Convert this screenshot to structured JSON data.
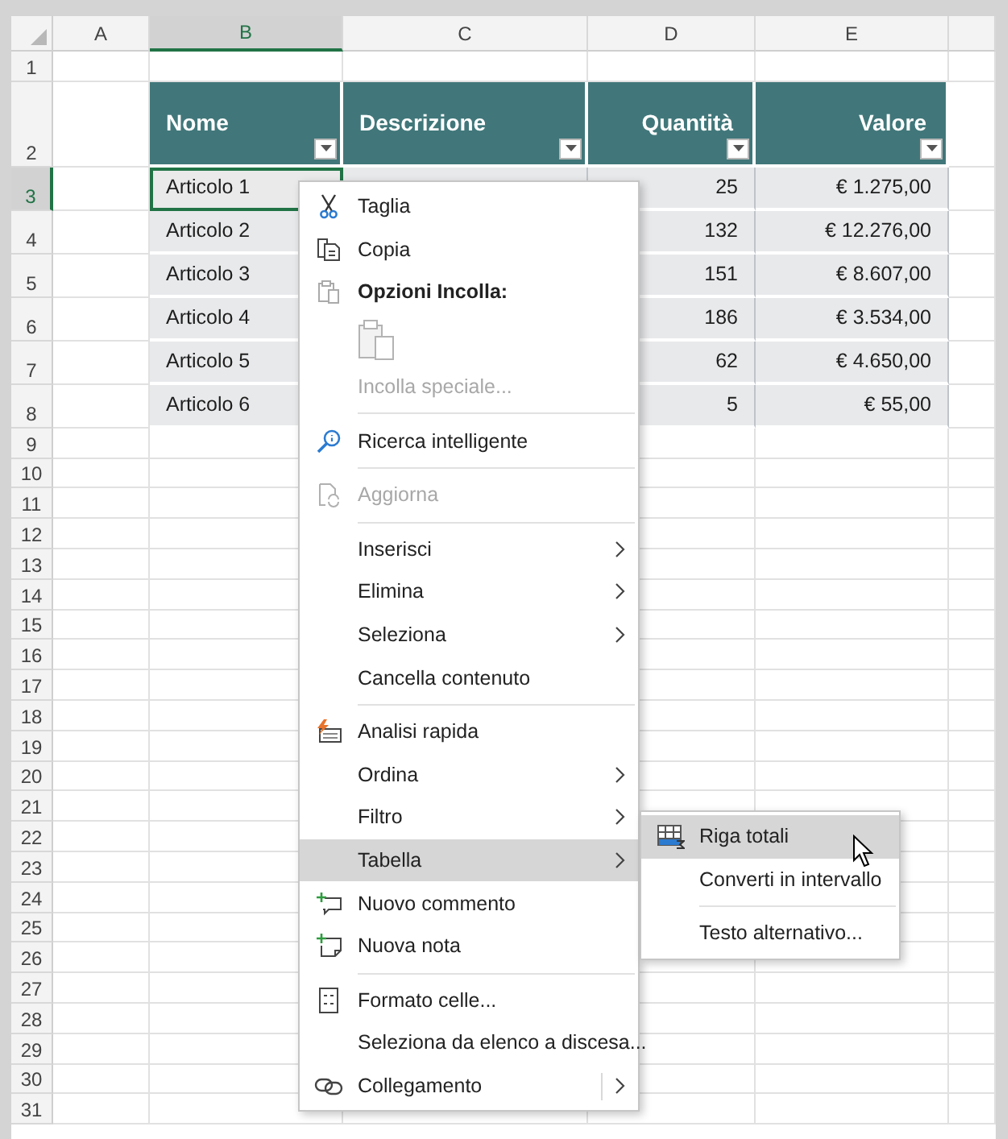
{
  "columns": [
    {
      "label": "A",
      "selected": false
    },
    {
      "label": "B",
      "selected": true
    },
    {
      "label": "C",
      "selected": false
    },
    {
      "label": "D",
      "selected": false
    },
    {
      "label": "E",
      "selected": false
    }
  ],
  "rows": [
    {
      "label": "1",
      "selected": false
    },
    {
      "label": "2",
      "selected": false
    },
    {
      "label": "3",
      "selected": true
    },
    {
      "label": "4",
      "selected": false
    },
    {
      "label": "5",
      "selected": false
    },
    {
      "label": "6",
      "selected": false
    },
    {
      "label": "7",
      "selected": false
    },
    {
      "label": "8",
      "selected": false
    },
    {
      "label": "9",
      "selected": false
    },
    {
      "label": "10",
      "selected": false
    },
    {
      "label": "11",
      "selected": false
    },
    {
      "label": "12",
      "selected": false
    },
    {
      "label": "13",
      "selected": false
    },
    {
      "label": "14",
      "selected": false
    },
    {
      "label": "15",
      "selected": false
    },
    {
      "label": "16",
      "selected": false
    },
    {
      "label": "17",
      "selected": false
    },
    {
      "label": "18",
      "selected": false
    },
    {
      "label": "19",
      "selected": false
    },
    {
      "label": "20",
      "selected": false
    },
    {
      "label": "21",
      "selected": false
    },
    {
      "label": "22",
      "selected": false
    },
    {
      "label": "23",
      "selected": false
    },
    {
      "label": "24",
      "selected": false
    },
    {
      "label": "25",
      "selected": false
    },
    {
      "label": "26",
      "selected": false
    },
    {
      "label": "27",
      "selected": false
    },
    {
      "label": "28",
      "selected": false
    },
    {
      "label": "29",
      "selected": false
    },
    {
      "label": "30",
      "selected": false
    },
    {
      "label": "31",
      "selected": false
    }
  ],
  "table": {
    "headers": [
      {
        "label": "Nome",
        "kind": "text"
      },
      {
        "label": "Descrizione",
        "kind": "text"
      },
      {
        "label": "Quantità",
        "kind": "number"
      },
      {
        "label": "Valore",
        "kind": "number"
      }
    ],
    "rows": [
      {
        "nome": "Articolo 1",
        "quantita": "25",
        "valore": "€ 1.275,00",
        "active": true
      },
      {
        "nome": "Articolo 2",
        "quantita": "132",
        "valore": "€ 12.276,00",
        "active": false
      },
      {
        "nome": "Articolo 3",
        "quantita": "151",
        "valore": "€ 8.607,00",
        "active": false
      },
      {
        "nome": "Articolo 4",
        "quantita": "186",
        "valore": "€ 3.534,00",
        "active": false
      },
      {
        "nome": "Articolo 5",
        "quantita": "62",
        "valore": "€ 4.650,00",
        "active": false
      },
      {
        "nome": "Articolo 6",
        "quantita": "5",
        "valore": "€ 55,00",
        "active": false
      }
    ]
  },
  "context_menu": {
    "items": [
      {
        "kind": "item",
        "label": "Taglia",
        "disabled": false,
        "submenu": false,
        "selected": false
      },
      {
        "kind": "item",
        "label": "Copia",
        "disabled": false,
        "submenu": false,
        "selected": false
      },
      {
        "kind": "header",
        "label": "Opzioni Incolla:"
      },
      {
        "kind": "paste-icons"
      },
      {
        "kind": "item",
        "label": "Incolla speciale...",
        "disabled": true,
        "submenu": false,
        "selected": false
      },
      {
        "kind": "separator"
      },
      {
        "kind": "item",
        "label": "Ricerca intelligente",
        "disabled": false,
        "submenu": false,
        "selected": false
      },
      {
        "kind": "separator"
      },
      {
        "kind": "item",
        "label": "Aggiorna",
        "disabled": true,
        "submenu": false,
        "selected": false
      },
      {
        "kind": "separator"
      },
      {
        "kind": "item",
        "label": "Inserisci",
        "disabled": false,
        "submenu": true,
        "selected": false
      },
      {
        "kind": "item",
        "label": "Elimina",
        "disabled": false,
        "submenu": true,
        "selected": false
      },
      {
        "kind": "item",
        "label": "Seleziona",
        "disabled": false,
        "submenu": true,
        "selected": false
      },
      {
        "kind": "item",
        "label": "Cancella contenuto",
        "disabled": false,
        "submenu": false,
        "selected": false
      },
      {
        "kind": "separator"
      },
      {
        "kind": "item",
        "label": "Analisi rapida",
        "disabled": false,
        "submenu": false,
        "selected": false
      },
      {
        "kind": "item",
        "label": "Ordina",
        "disabled": false,
        "submenu": true,
        "selected": false
      },
      {
        "kind": "item",
        "label": "Filtro",
        "disabled": false,
        "submenu": true,
        "selected": false
      },
      {
        "kind": "item",
        "label": "Tabella",
        "disabled": false,
        "submenu": true,
        "selected": true
      },
      {
        "kind": "item",
        "label": "Nuovo commento",
        "disabled": false,
        "submenu": false,
        "selected": false
      },
      {
        "kind": "item",
        "label": "Nuova nota",
        "disabled": false,
        "submenu": false,
        "selected": false
      },
      {
        "kind": "separator"
      },
      {
        "kind": "item",
        "label": "Formato celle...",
        "disabled": false,
        "submenu": false,
        "selected": false
      },
      {
        "kind": "item",
        "label": "Seleziona da elenco a discesa...",
        "disabled": false,
        "submenu": false,
        "selected": false
      },
      {
        "kind": "split",
        "label": "Collegamento",
        "disabled": false,
        "submenu": true,
        "selected": false
      }
    ]
  },
  "submenu": {
    "items": [
      {
        "kind": "item",
        "label": "Riga totali",
        "selected": true
      },
      {
        "kind": "item",
        "label": "Converti in intervallo",
        "selected": false
      },
      {
        "kind": "separator"
      },
      {
        "kind": "item",
        "label": "Testo alternativo...",
        "selected": false
      }
    ]
  }
}
